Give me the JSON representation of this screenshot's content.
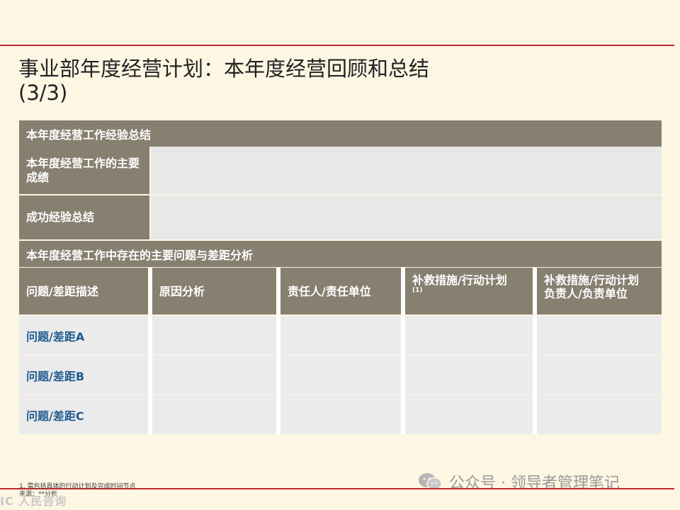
{
  "title": {
    "line1": "事业部年度经营计划：本年度经营回顾和总结",
    "line2": "(3/3)"
  },
  "section1": {
    "heading": "本年度经营工作经验总结"
  },
  "row_achievements": {
    "label": "本年度经营工作的主要成绩"
  },
  "row_success": {
    "label": "成功经验总结"
  },
  "section2": {
    "heading": "本年度经营工作中存在的主要问题与差距分析"
  },
  "columns": [
    {
      "label": "问题/差距描述"
    },
    {
      "label": "原因分析"
    },
    {
      "label": "责任人/责任单位"
    },
    {
      "label": "补救措施/行动计划",
      "note": "(1)"
    },
    {
      "label": "补救措施/行动计划 负责人/负责单位"
    }
  ],
  "rows": [
    {
      "issue": "问题/差距A"
    },
    {
      "issue": "问题/差距B"
    },
    {
      "issue": "问题/差距C"
    }
  ],
  "footnote": {
    "line1": "1. 需包括具体的行动计划及完成时间节点",
    "line2": "来源：**分析"
  },
  "watermark": {
    "text": "公众号 · 领导者管理笔记"
  },
  "watermark_left": {
    "text": "IC 人民咨询"
  },
  "colors": {
    "header_band": "#878070",
    "accent_line": "#c0282d",
    "issue_text": "#1f5b8f",
    "cell_fill": "#ebebeb"
  }
}
